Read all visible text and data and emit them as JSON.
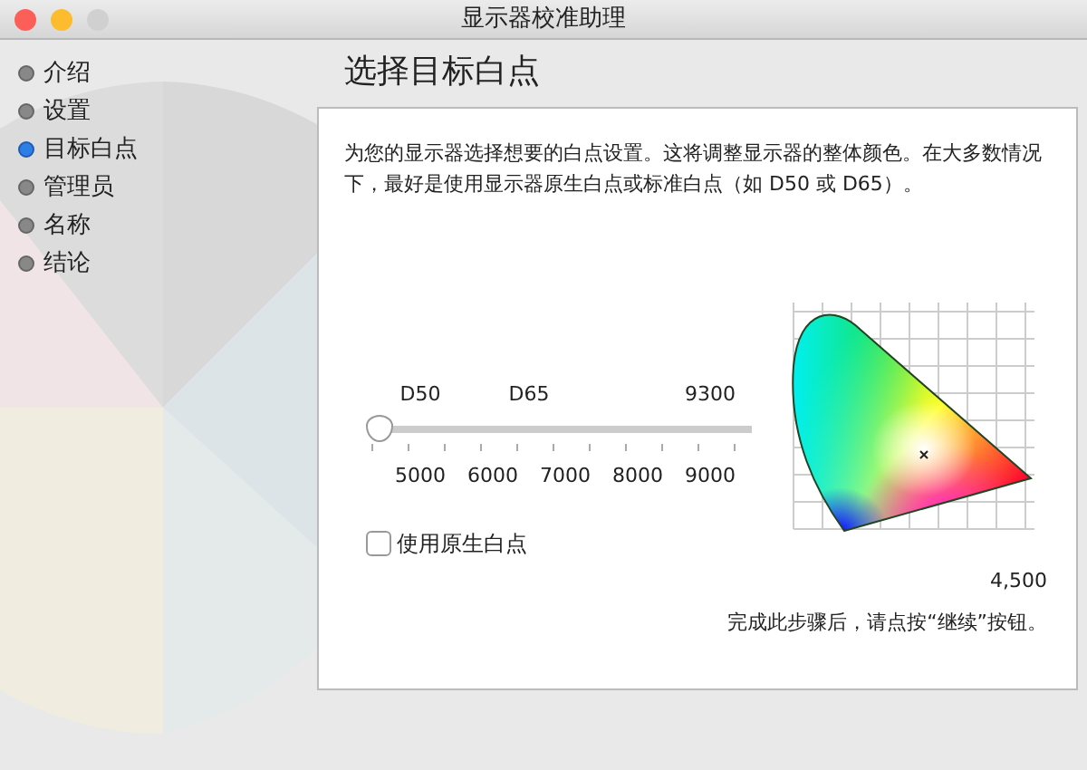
{
  "window": {
    "title": "显示器校准助理"
  },
  "steps": [
    {
      "label": "介绍",
      "selected": false
    },
    {
      "label": "设置",
      "selected": false
    },
    {
      "label": "目标白点",
      "selected": true
    },
    {
      "label": "管理员",
      "selected": false
    },
    {
      "label": "名称",
      "selected": false
    },
    {
      "label": "结论",
      "selected": false
    }
  ],
  "heading": "选择目标白点",
  "description": "为您的显示器选择想要的白点设置。这将调整显示器的整体颜色。在大多数情况下，最好是使用显示器原生白点或标准白点（如 D50 或 D65）。",
  "slider": {
    "top_labels": [
      "D50",
      "D65",
      "9300"
    ],
    "bottom_labels": [
      "5000",
      "6000",
      "7000",
      "8000",
      "9000"
    ],
    "level": 0
  },
  "native_checkbox": {
    "label": "使用原生白点",
    "checked": false
  },
  "temperature": "4,500",
  "footer": "完成此步骤后，请点按“继续”按钮。"
}
